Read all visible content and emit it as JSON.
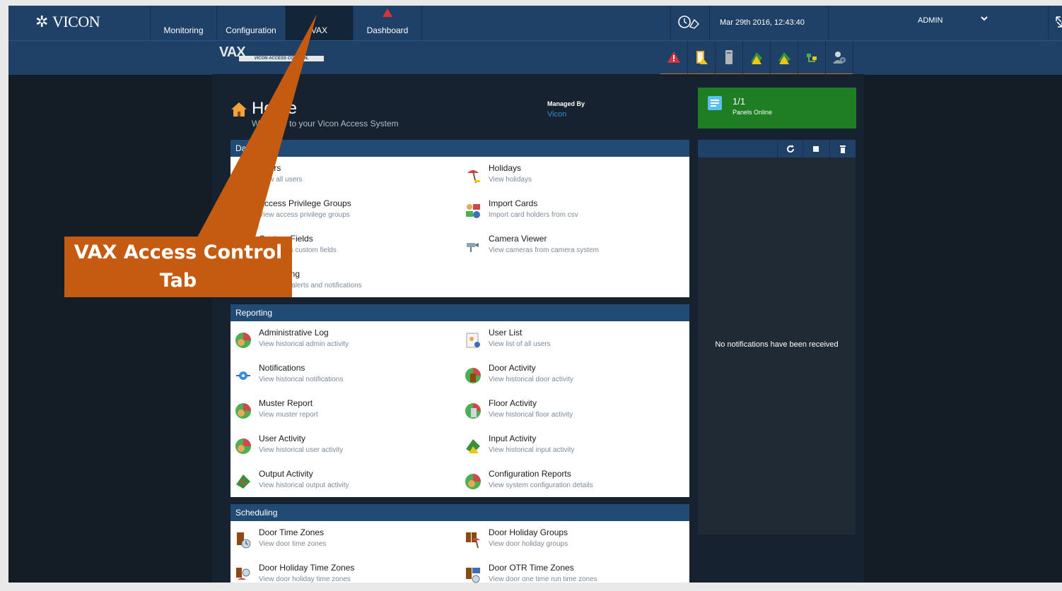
{
  "app": {
    "brand": "VICON",
    "nav_tabs": [
      {
        "label": "Monitoring"
      },
      {
        "label": "Configuration"
      },
      {
        "label": "VAX"
      },
      {
        "label": "Dashboard"
      }
    ],
    "datetime": "Mar 29th 2016, 12:43:40",
    "user": "ADMIN"
  },
  "subheader": {
    "logo_text": "VAX",
    "logo_strip": "VICON ACCESS CONTROL",
    "icons": [
      "alert-icon",
      "door-icon",
      "reader-icon",
      "input-warning-icon",
      "output-warning-icon",
      "network-icon",
      "user-settings-icon"
    ]
  },
  "home": {
    "title": "Home",
    "subtitle": "Welcome to your Vicon Access System",
    "managed_by_label": "Managed By",
    "managed_by_value": "Vicon"
  },
  "sections": {
    "database": {
      "title": "Database",
      "items": [
        {
          "title": "Users",
          "subtitle": "View all users"
        },
        {
          "title": "Holidays",
          "subtitle": "View holidays"
        },
        {
          "title": "Access Privilege Groups",
          "subtitle": "View access privilege groups"
        },
        {
          "title": "Import Cards",
          "subtitle": "Import card holders from csv"
        },
        {
          "title": "Custom Fields",
          "subtitle": "View users custom fields"
        },
        {
          "title": "Camera Viewer",
          "subtitle": "View cameras from camera system"
        },
        {
          "title": "Messaging",
          "subtitle": "Configure alerts and notifications"
        }
      ]
    },
    "reporting": {
      "title": "Reporting",
      "items": [
        {
          "title": "Administrative Log",
          "subtitle": "View historical admin activity"
        },
        {
          "title": "User List",
          "subtitle": "View list of all users"
        },
        {
          "title": "Notifications",
          "subtitle": "View historical notifications"
        },
        {
          "title": "Door Activity",
          "subtitle": "View historical door activity"
        },
        {
          "title": "Muster Report",
          "subtitle": "View muster report"
        },
        {
          "title": "Floor Activity",
          "subtitle": "View historical floor activity"
        },
        {
          "title": "User Activity",
          "subtitle": "View historical user activity"
        },
        {
          "title": "Input Activity",
          "subtitle": "View historical input activity"
        },
        {
          "title": "Output Activity",
          "subtitle": "View historical output activity"
        },
        {
          "title": "Configuration Reports",
          "subtitle": "View system configuration details"
        }
      ]
    },
    "scheduling": {
      "title": "Scheduling",
      "items": [
        {
          "title": "Door Time Zones",
          "subtitle": "View door time zones"
        },
        {
          "title": "Door Holiday Groups",
          "subtitle": "View door holiday groups"
        },
        {
          "title": "Door Holiday Time Zones",
          "subtitle": "View door holiday time zones"
        },
        {
          "title": "Door OTR Time Zones",
          "subtitle": "View door one time run time zones"
        }
      ]
    }
  },
  "panels": {
    "count": "1/1",
    "label": "Panels Online"
  },
  "notifications": {
    "empty_message": "No notifications have been received"
  },
  "callout": {
    "line1": "VAX Access Control",
    "line2": "Tab",
    "color": "#c55a11"
  }
}
